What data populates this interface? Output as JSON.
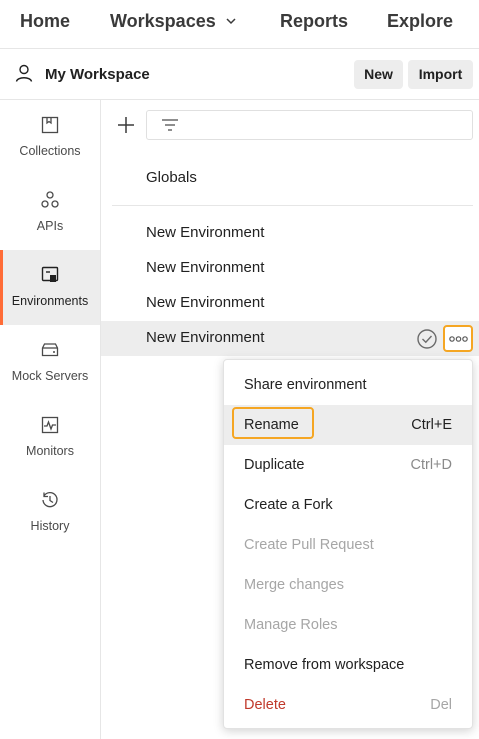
{
  "topnav": {
    "home": "Home",
    "workspaces": "Workspaces",
    "reports": "Reports",
    "explore": "Explore"
  },
  "workspace": {
    "title": "My Workspace",
    "new_label": "New",
    "import_label": "Import"
  },
  "sidebar": {
    "items": [
      {
        "label": "Collections",
        "icon": "collections-icon"
      },
      {
        "label": "APIs",
        "icon": "apis-icon"
      },
      {
        "label": "Environments",
        "icon": "environments-icon",
        "active": true
      },
      {
        "label": "Mock Servers",
        "icon": "mock-servers-icon"
      },
      {
        "label": "Monitors",
        "icon": "monitors-icon"
      },
      {
        "label": "History",
        "icon": "history-icon"
      }
    ]
  },
  "main": {
    "globals_label": "Globals",
    "environments": [
      {
        "label": "New Environment"
      },
      {
        "label": "New Environment"
      },
      {
        "label": "New Environment"
      },
      {
        "label": "New Environment",
        "selected": true
      }
    ]
  },
  "menu": {
    "items": [
      {
        "label": "Share environment",
        "shortcut": ""
      },
      {
        "label": "Rename",
        "shortcut": "Ctrl+E",
        "highlighted": true
      },
      {
        "label": "Duplicate",
        "shortcut": "Ctrl+D"
      },
      {
        "label": "Create a Fork",
        "shortcut": ""
      },
      {
        "label": "Create Pull Request",
        "shortcut": "",
        "disabled": true
      },
      {
        "label": "Merge changes",
        "shortcut": "",
        "disabled": true
      },
      {
        "label": "Manage Roles",
        "shortcut": "",
        "disabled": true
      },
      {
        "label": "Remove from workspace",
        "shortcut": ""
      },
      {
        "label": "Delete",
        "shortcut": "Del",
        "danger": true
      }
    ]
  },
  "colors": {
    "accent_orange": "#ff6c37",
    "highlight_outline": "#f5a623",
    "danger_red": "#c0392b",
    "selected_bg": "#ededed"
  }
}
